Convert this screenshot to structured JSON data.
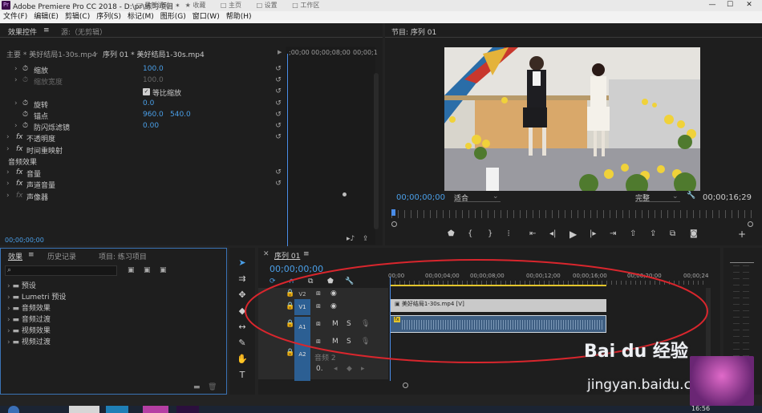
{
  "titlebar": {
    "app_icon": "Pr",
    "title": "Adobe Premiere Pro CC 2018 - D:\\pr\\练习项目 *",
    "bg_tabs": [
      "□ 最新活动",
      "★ 收藏",
      "□ 主页",
      "□ 设置",
      "□ 工作区"
    ],
    "min": "—",
    "max": "☐",
    "close": "✕"
  },
  "menubar": [
    "文件(F)",
    "编辑(E)",
    "剪辑(C)",
    "序列(S)",
    "标记(M)",
    "图形(G)",
    "窗口(W)",
    "帮助(H)"
  ],
  "effect_controls": {
    "tab": "效果控件",
    "tab_menu": "≡",
    "source": "源:（无剪辑）",
    "master": "主要 * 美好结局1-30s.mp4",
    "sequence": "序列 01 * 美好结局1-30s.mp4",
    "ruler_start": ";00;00",
    "ruler_mid": "00;00;08;00",
    "ruler_end": "00;00;1",
    "rows": [
      {
        "label": "缩放",
        "value": "100.0"
      },
      {
        "label": "缩放宽度",
        "value": "100.0"
      },
      {
        "label": "等比缩放"
      },
      {
        "label": "旋转",
        "value": "0.0"
      },
      {
        "label": "锚点",
        "value": "960.0",
        "value2": "540.0"
      },
      {
        "label": "防闪烁滤镜",
        "value": "0.00"
      }
    ],
    "fx_opacity": "不透明度",
    "fx_time": "时间重映射",
    "audio_section": "音频效果",
    "audio_rows": [
      "音量",
      "声道音量",
      "声像器"
    ],
    "timecode": "00;00;00;00"
  },
  "program": {
    "title": "节目: 序列 01",
    "timecode": "00;00;00;00",
    "fit": "适合",
    "quality": "完整",
    "duration": "00;00;16;29"
  },
  "project": {
    "tabs": [
      "效果",
      "历史记录",
      "项目: 练习项目"
    ],
    "folders": [
      "预设",
      "Lumetri 预设",
      "音频效果",
      "音频过渡",
      "视频效果",
      "视频过渡"
    ]
  },
  "timeline": {
    "title": "序列 01",
    "timecode": "00;00;00;00",
    "ruler": [
      "00;00",
      "00;00;04;00",
      "00;00;08;00",
      "00;00;12;00",
      "00;00;16;00",
      "00;00;20;00",
      "00;00;24"
    ],
    "tracks": [
      {
        "name": "V2"
      },
      {
        "name": "V1"
      },
      {
        "name": "A1"
      },
      {
        "name": ""
      },
      {
        "name": "A2"
      }
    ],
    "track_btn_m": "M",
    "track_btn_s": "S",
    "audio2": "音频 2",
    "audio2_level": "0.",
    "clip_video": "美好结局1-30s.mp4 [V]",
    "clip_audio_badge": "fx"
  },
  "colors": {
    "accent": "#4a9fe8",
    "track": "#2c5f93",
    "annotation": "#d9262d",
    "playhead": "#4a8de8"
  },
  "watermark": {
    "brand": "Bai du 经验",
    "url": "jingyan.baidu.com"
  },
  "taskbar_time": "16:56"
}
